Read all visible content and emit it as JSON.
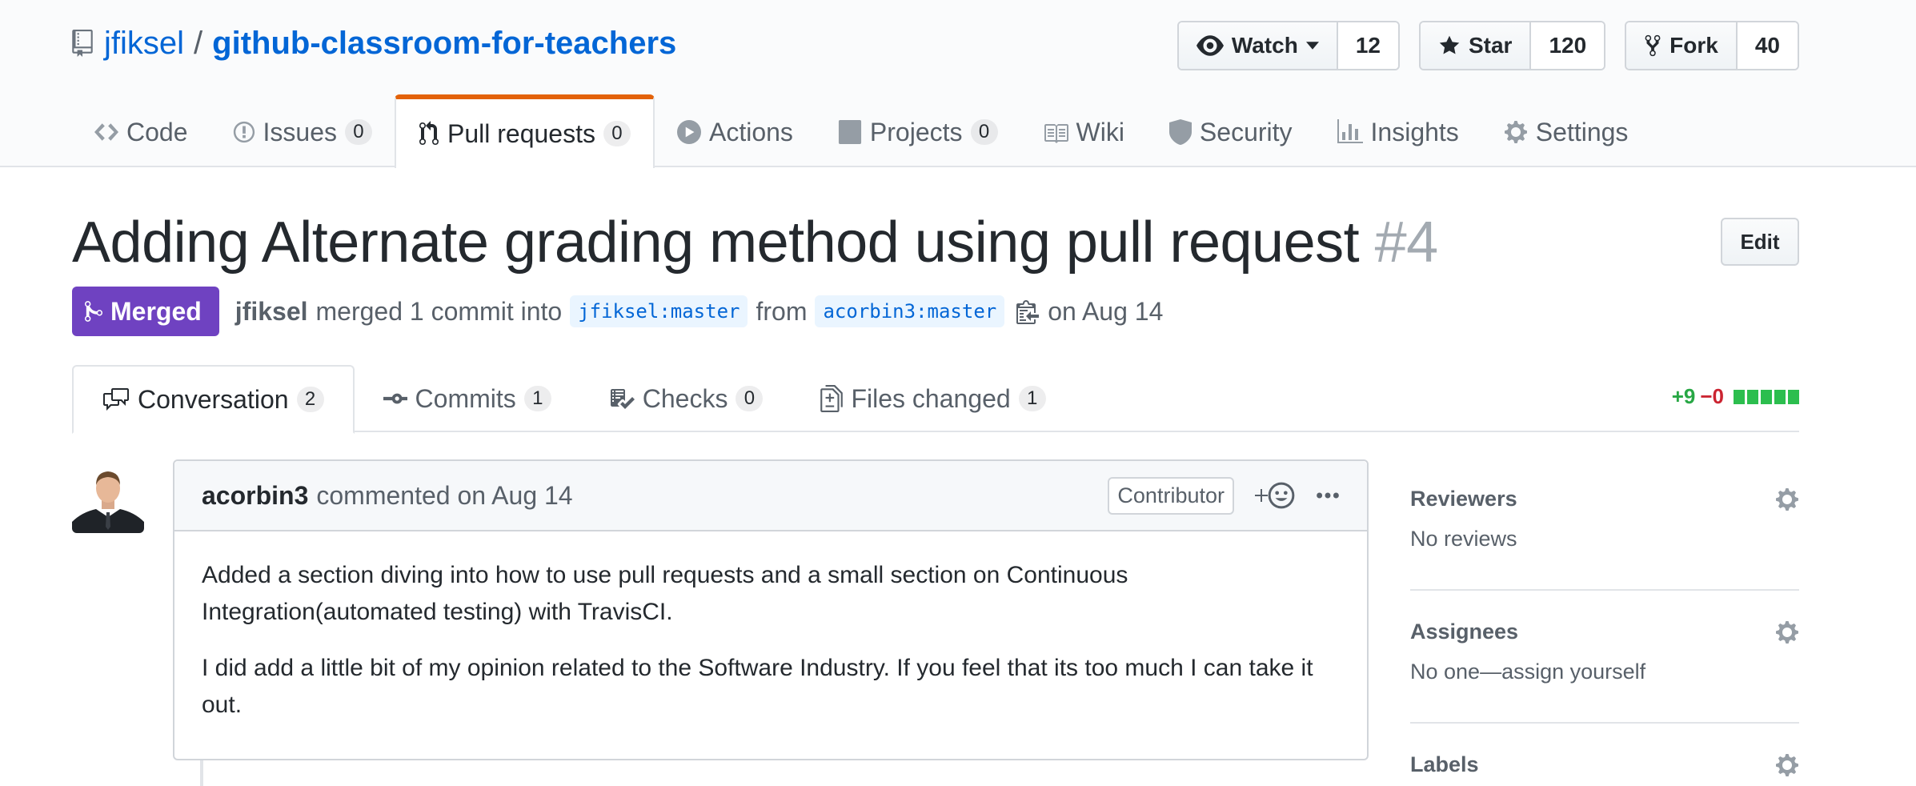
{
  "repo": {
    "owner": "jfiksel",
    "separator": "/",
    "name": "github-classroom-for-teachers",
    "actions": [
      {
        "label": "Watch",
        "count": "12"
      },
      {
        "label": "Star",
        "count": "120"
      },
      {
        "label": "Fork",
        "count": "40"
      }
    ]
  },
  "reponav": {
    "code": {
      "label": "Code"
    },
    "issues": {
      "label": "Issues",
      "count": "0"
    },
    "pulls": {
      "label": "Pull requests",
      "count": "0"
    },
    "actions": {
      "label": "Actions"
    },
    "projects": {
      "label": "Projects",
      "count": "0"
    },
    "wiki": {
      "label": "Wiki"
    },
    "security": {
      "label": "Security"
    },
    "insights": {
      "label": "Insights"
    },
    "settings": {
      "label": "Settings"
    }
  },
  "pr": {
    "title": "Adding Alternate grading method using pull request",
    "number": "#4",
    "edit_label": "Edit",
    "state": "Merged",
    "merger": "jfiksel",
    "merged_text": "merged 1 commit into",
    "base_branch": "jfiksel:master",
    "from_text": "from",
    "head_branch": "acorbin3:master",
    "date_text": "on Aug 14"
  },
  "tabs": {
    "conversation": {
      "label": "Conversation",
      "count": "2"
    },
    "commits": {
      "label": "Commits",
      "count": "1"
    },
    "checks": {
      "label": "Checks",
      "count": "0"
    },
    "files": {
      "label": "Files changed",
      "count": "1"
    },
    "additions": "+9",
    "deletions": "−0"
  },
  "comment": {
    "author": "acorbin3",
    "action": "commented on Aug 14",
    "role_label": "Contributor",
    "paragraph1": "Added a section diving into how to use pull requests and a small section on Continuous Integration(automated testing) with TravisCI.",
    "paragraph2": "I did add a little bit of my opinion related to the Software Industry. If you feel that its too much I can take it out."
  },
  "sidebar": {
    "reviewers": {
      "heading": "Reviewers",
      "value": "No reviews"
    },
    "assignees": {
      "heading": "Assignees",
      "value": "No one—assign yourself"
    },
    "labels": {
      "heading": "Labels"
    }
  }
}
